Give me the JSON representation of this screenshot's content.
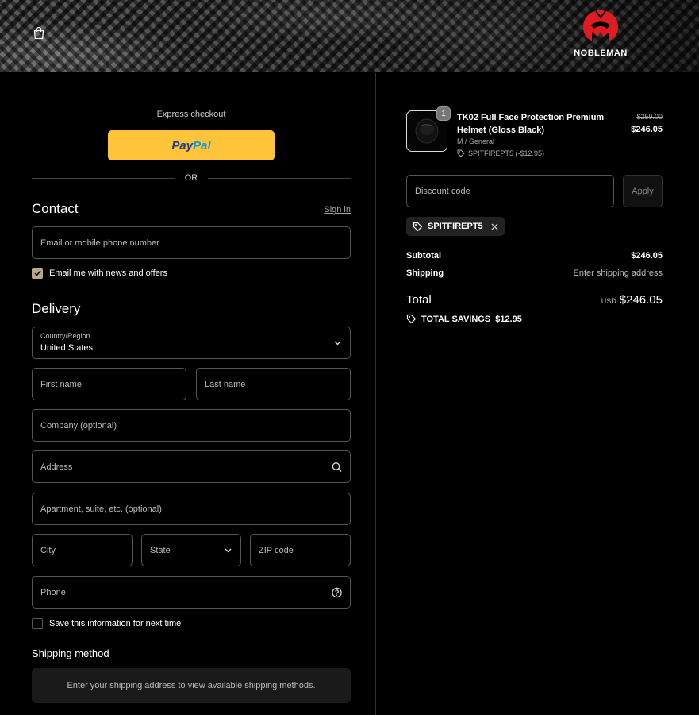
{
  "brand": {
    "logo_text": "NOBLEMAN"
  },
  "express": {
    "label": "Express checkout",
    "paypal_part1": "Pay",
    "paypal_part2": "Pal",
    "or": "OR"
  },
  "contact": {
    "title": "Contact",
    "sign_in": "Sign in",
    "email_placeholder": "Email or mobile phone number",
    "newsletter_label": "Email me with news and offers",
    "newsletter_checked": true
  },
  "delivery": {
    "title": "Delivery",
    "country_label": "Country/Region",
    "country_value": "United States",
    "first_name": "First name",
    "last_name": "Last name",
    "company": "Company (optional)",
    "address": "Address",
    "apartment": "Apartment, suite, etc. (optional)",
    "city": "City",
    "state": "State",
    "zip": "ZIP code",
    "phone": "Phone",
    "save_info": "Save this information for next time",
    "save_info_checked": false
  },
  "shipping_method": {
    "title": "Shipping method",
    "info": "Enter your shipping address to view available shipping methods."
  },
  "order": {
    "item": {
      "quantity": "1",
      "name": "TK02 Full Face Protection Premium Helmet (Gloss Black)",
      "variant": "M / General",
      "discount": "SPITFIREPT5 (-$12.95)",
      "price_original": "$259.00",
      "price": "$246.05"
    },
    "discount_placeholder": "Discount code",
    "apply": "Apply",
    "applied_code": "SPITFIREPT5",
    "subtotal_label": "Subtotal",
    "subtotal_value": "$246.05",
    "shipping_label": "Shipping",
    "shipping_value": "Enter shipping address",
    "total_label": "Total",
    "currency": "USD",
    "total_value": "$246.05",
    "savings_label": "TOTAL SAVINGS",
    "savings_value": "$12.95"
  },
  "colors": {
    "paypal": "#ffc43a",
    "accent_checkbox": "#b8a88a",
    "logo_red": "#e01b22"
  }
}
